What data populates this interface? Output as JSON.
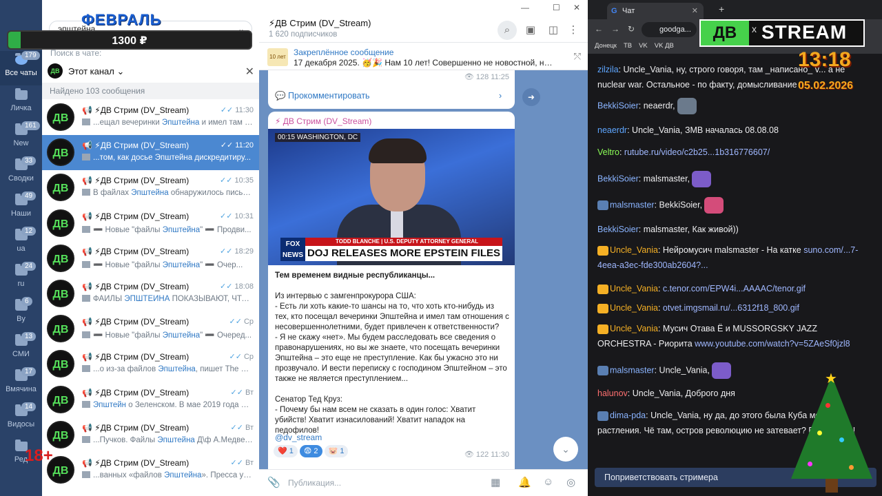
{
  "folders": [
    {
      "label": "Все чаты",
      "badge": "179",
      "active": true
    },
    {
      "label": "Личка",
      "badge": ""
    },
    {
      "label": "New",
      "badge": "161"
    },
    {
      "label": "Сводки",
      "badge": "33"
    },
    {
      "label": "Наши",
      "badge": "49"
    },
    {
      "label": "ua",
      "badge": "12"
    },
    {
      "label": "ru",
      "badge": "24"
    },
    {
      "label": "By",
      "badge": "6"
    },
    {
      "label": "СМИ",
      "badge": "13"
    },
    {
      "label": "Вмячина",
      "badge": "17"
    },
    {
      "label": "Видосы",
      "badge": "14"
    },
    {
      "label": "Ред",
      "badge": ""
    }
  ],
  "overlay": {
    "month": "ФЕВРАЛЬ",
    "amount": "1300 ₽",
    "goal_fraction": 0.05,
    "age": "18+"
  },
  "search": {
    "query": "эпштейна",
    "hint": "Поиск в чате:",
    "scope": "Этот канал",
    "found": "Найдено 103 сообщения"
  },
  "results": [
    {
      "name": "📢 ⚡ДВ Стрим (DV_Stream)",
      "time": "11:30",
      "pre": "...ещал вечеринки ",
      "hl": "Эпштейна",
      "post": " и имел там от..."
    },
    {
      "name": "📢 ⚡ДВ Стрим (DV_Stream)",
      "time": "11:20",
      "pre": "...том, как досье Эпштейна дискредитиру...",
      "hl": "",
      "post": ""
    },
    {
      "name": "📢 ⚡ДВ Стрим (DV_Stream)",
      "time": "10:35",
      "pre": "В файлах ",
      "hl": "Эпштейна",
      "post": " обнаружилось письмо..."
    },
    {
      "name": "📢 ⚡ДВ Стрим (DV_Stream)",
      "time": "10:31",
      "pre": "➖ Новые \"файлы ",
      "hl": "Эпштейна",
      "post": "\" ➖ Продви..."
    },
    {
      "name": "📢 ⚡ДВ Стрим (DV_Stream)",
      "time": "18:29",
      "pre": "➖ Новые \"файлы ",
      "hl": "Эпштейна",
      "post": "\" ➖ Очер..."
    },
    {
      "name": "📢 ⚡ДВ Стрим (DV_Stream)",
      "time": "18:08",
      "pre": "ФАЙЛЫ ",
      "hl": "ЭПШТЕЙНА",
      "post": " ПОКАЗЫВАЮТ, ЧТО ЕВ..."
    },
    {
      "name": "📢 ⚡ДВ Стрим (DV_Stream)",
      "time": "Ср",
      "pre": "➖ Новые \"файлы ",
      "hl": "Эпштейна",
      "post": "\" ➖ Очеред..."
    },
    {
      "name": "📢 ⚡ДВ Стрим (DV_Stream)",
      "time": "Ср",
      "pre": "...о из-за файлов ",
      "hl": "Эпштейна",
      "post": ", пишет The Sun..."
    },
    {
      "name": "📢 ⚡ДВ Стрим (DV_Stream)",
      "time": "Вт",
      "pre": "",
      "hl": "Эпштейн",
      "post": " о Зеленском. В мае 2019 года Дж..."
    },
    {
      "name": "📢 ⚡ДВ Стрим (DV_Stream)",
      "time": "Вт",
      "pre": "...Пучков. Файлы ",
      "hl": "Эпштейна",
      "post": " Д\\ф А.Медведе..."
    },
    {
      "name": "📢 ⚡ДВ Стрим (DV_Stream)",
      "time": "Вт",
      "pre": "...ванных «файлов ",
      "hl": "Эпштейна",
      "post": "». Пресса уже ..."
    }
  ],
  "channel": {
    "title": "⚡ДВ Стрим (DV_Stream)",
    "subs": "1 620 подписчиков",
    "pinned_title": "Закреплённое сообщение",
    "pinned_text": "17 декабря 2025. 🥳🎉 Нам 10 лет! Совершенно не новостной, но в ч...",
    "pinned_img": "10 лет",
    "prev_views": "128",
    "prev_time": "11:25",
    "comment": "Прокомментировать",
    "post_author": "⚡ ДВ Стрим (DV_Stream)",
    "video_loc": "00:15  WASHINGTON, DC",
    "video_strip1": "TODD BLANCHE | U.S. DEPUTY ATTORNEY GENERAL",
    "video_strip2": "DOJ RELEASES MORE EPSTEIN FILES",
    "video_fox": "FOX NEWS",
    "p1": "Тем временем видные республиканцы...",
    "p2": "Из интервью с замгенпрокурора США:\n- Есть ли хоть какие-то шансы на то, что хоть кто-нибудь из тех, кто посещал вечеринки Эпштейна и имел там отношения с несовершеннолетними, будет привлечен к ответственности?\n- Я не скажу «нет». Мы будем расследовать все сведения о правонарушениях, но вы же знаете, что посещать вечеринки Эпштейна – это еще не преступление. Как бы ужасно это ни прозвучало. И вести переписку с господином Эпштейном – это также не является преступлением...",
    "p3": "Сенатор Тед Круз:\n- Почему бы нам всем не сказать в один голос: Хватит убийств! Хватит изнасилований! Хватит нападок на педофилов!",
    "link": "@dv_stream",
    "reactions": [
      {
        "e": "❤️",
        "n": "1",
        "sel": false
      },
      {
        "e": "😨",
        "n": "2",
        "sel": true
      },
      {
        "e": "🐷",
        "n": "1",
        "sel": false
      }
    ],
    "views": "122",
    "time": "11:30",
    "composer": "Публикация..."
  },
  "browser": {
    "tab": "Чат",
    "url": "goodga...",
    "bookmarks": [
      "Донецк",
      "ТВ",
      "VK",
      "VK ДВ"
    ]
  },
  "stream": {
    "logo_left": "ДВ",
    "logo_x": "x",
    "logo_right": "STREAM",
    "clock": "13:18",
    "date": "05.02.2026"
  },
  "chat": [
    {
      "user": "zilzila",
      "color": "#5ea6ff",
      "text": "Uncle_Vania, ну, строго говоря, там _написано_ v... а не nuclear war. Остальное - по факту, домысливание"
    },
    {
      "user": "BekkiSoier",
      "color": "#8ab4ff",
      "text": "neaerdr,"
    },
    {
      "user": "neaerdr",
      "color": "#5ea6ff",
      "text": "Uncle_Vania, ЗМВ началась 08.08.08"
    },
    {
      "user": "Veltro",
      "color": "#8bff56",
      "text": "",
      "link": "rutube.ru/video/c2b25...1b316776607/"
    },
    {
      "user": "BekkiSoier",
      "color": "#8ab4ff",
      "text": "malsmaster,"
    },
    {
      "user": "malsmaster",
      "color": "#8ab4ff",
      "text": "BekkiSoier,"
    },
    {
      "user": "BekkiSoier",
      "color": "#8ab4ff",
      "text": "malsmaster, Как живой))"
    },
    {
      "user": "Uncle_Vania",
      "color": "#f5b025",
      "text": "Нейромусич    malsmaster - На катке",
      "link": "suno.com/...7-4eea-a3ec-fde300ab2604?..."
    },
    {
      "user": "Uncle_Vania",
      "color": "#f5b025",
      "text": "",
      "link": "c.tenor.com/EPW4i...AAAAC/tenor.gif"
    },
    {
      "user": "Uncle_Vania",
      "color": "#f5b025",
      "text": "",
      "link": "otvet.imgsmail.ru/...6312f18_800.gif"
    },
    {
      "user": "Uncle_Vania",
      "color": "#f5b025",
      "text": "Мусич      Отава Ё и MUSSORGSKY JAZZ ORCHESTRA - Риорита",
      "link": "www.youtube.com/watch?v=5ZAeSf0jzl8"
    },
    {
      "user": "malsmaster",
      "color": "#8ab4ff",
      "text": "Uncle_Vania,"
    },
    {
      "user": "halunov",
      "color": "#ff7070",
      "text": "Uncle_Vania, Доброго дня"
    },
    {
      "user": "dima-pda",
      "color": "#8ab4ff",
      "text": "Uncle_Vania, ну да, до этого была Куба местом растления. Чё там, остров революцию не затевает? Пом... ...им!"
    }
  ],
  "greet": "Поприветствовать стримера",
  "colors": {
    "accent": "#4b88d1",
    "rail": "#2a4268",
    "chat_bg": "#18181b",
    "stream_green": "#46d14b"
  }
}
